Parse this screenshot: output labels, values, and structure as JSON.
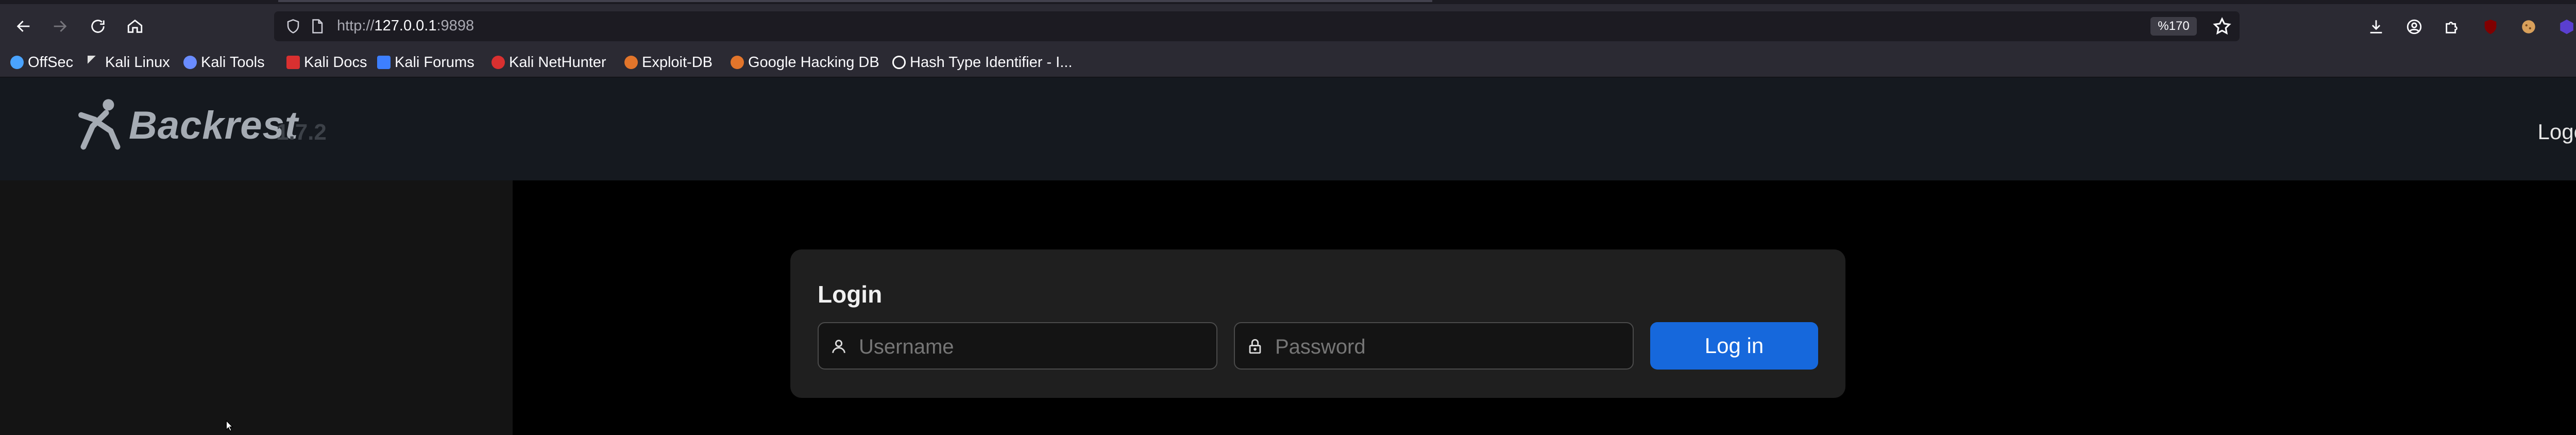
{
  "browser": {
    "url_scheme": "http://",
    "url_host": "127.0.0.1",
    "url_port": ":9898",
    "zoom": "%170",
    "bookmarks": [
      {
        "label": "OffSec",
        "icon": "offsec-icon",
        "color": "#4aa3ff"
      },
      {
        "label": "Kali Linux",
        "icon": "kali-dragon-icon",
        "color": "#e0e0e0"
      },
      {
        "label": "Kali Tools",
        "icon": "kali-tools-icon",
        "color": "#6a8cff"
      },
      {
        "label": "Kali Docs",
        "icon": "kali-docs-icon",
        "color": "#d93030"
      },
      {
        "label": "Kali Forums",
        "icon": "kali-forums-icon",
        "color": "#3d7fff"
      },
      {
        "label": "Kali NetHunter",
        "icon": "nethunter-icon",
        "color": "#d93030"
      },
      {
        "label": "Exploit-DB",
        "icon": "exploit-db-icon",
        "color": "#e2752b"
      },
      {
        "label": "Google Hacking DB",
        "icon": "ghdb-icon",
        "color": "#e2752b"
      },
      {
        "label": "Hash Type Identifier - I...",
        "icon": "hash-identifier-icon",
        "color": "#ffffff"
      }
    ]
  },
  "app": {
    "logo_text": "Backrest",
    "version": "1.7.2",
    "logout_label": "Logout",
    "accent": "#1668dc"
  },
  "login": {
    "title": "Login",
    "username_placeholder": "Username",
    "password_placeholder": "Password",
    "submit_label": "Log in"
  }
}
